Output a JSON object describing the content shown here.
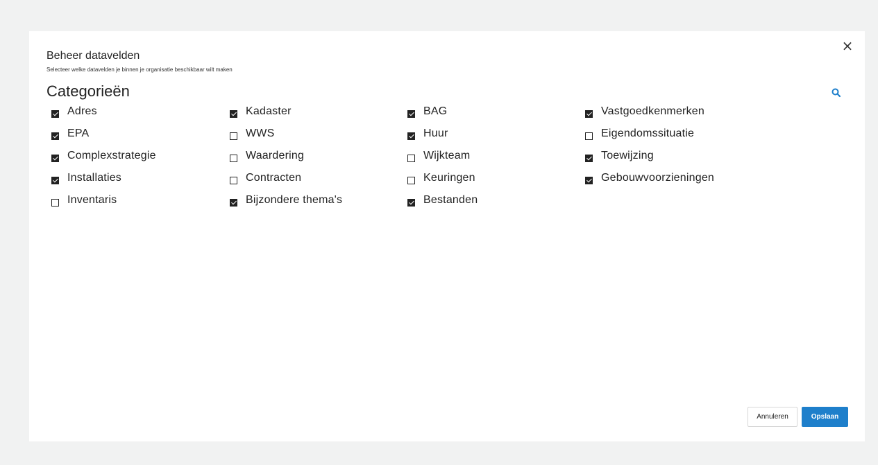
{
  "dialog": {
    "title": "Beheer datavelden",
    "subtitle": "Selecteer welke datavelden je binnen je organisatie beschikbaar wilt maken",
    "close_symbol": "×",
    "section_heading": "Categorieën"
  },
  "categories": [
    {
      "label": "Adres",
      "checked": true
    },
    {
      "label": "Kadaster",
      "checked": true
    },
    {
      "label": "BAG",
      "checked": true
    },
    {
      "label": "Vastgoedkenmerken",
      "checked": true
    },
    {
      "label": "EPA",
      "checked": true
    },
    {
      "label": "WWS",
      "checked": false
    },
    {
      "label": "Huur",
      "checked": true
    },
    {
      "label": "Eigendomssituatie",
      "checked": false
    },
    {
      "label": "Complexstrategie",
      "checked": true
    },
    {
      "label": "Waardering",
      "checked": false
    },
    {
      "label": "Wijkteam",
      "checked": false
    },
    {
      "label": "Toewijzing",
      "checked": true
    },
    {
      "label": "Installaties",
      "checked": true
    },
    {
      "label": "Contracten",
      "checked": false
    },
    {
      "label": "Keuringen",
      "checked": false
    },
    {
      "label": "Gebouwvoorzieningen",
      "checked": true
    },
    {
      "label": "Inventaris",
      "checked": false
    },
    {
      "label": "Bijzondere thema's",
      "checked": true
    },
    {
      "label": "Bestanden",
      "checked": true
    }
  ],
  "buttons": {
    "cancel_label": "Annuleren",
    "save_label": "Opslaan"
  },
  "icons": {
    "close": "close-icon",
    "search": "search-icon"
  },
  "colors": {
    "accent": "#1e7fcb",
    "background": "#f1f2f2",
    "text": "#222222"
  }
}
